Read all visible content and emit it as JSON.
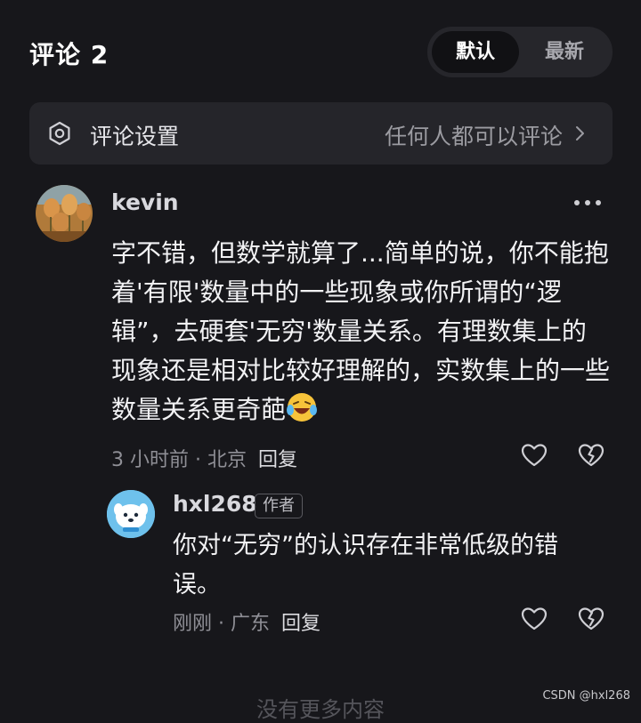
{
  "header": {
    "title": "评论 2"
  },
  "sort": {
    "default_label": "默认",
    "newest_label": "最新"
  },
  "settings": {
    "label": "评论设置",
    "value": "任何人都可以评论"
  },
  "comments": [
    {
      "username": "kevin",
      "text": "字不错，但数学就算了...简单的说，你不能抱着'有限'数量中的一些现象或你所谓的“逻辑”，去硬套'无穷'数量关系。有理数集上的现象还是相对比较好理解的，实数集上的一些数量关系更奇葩",
      "emoji": "laughing-tears-emoji",
      "time": "3 小时前",
      "location": "北京",
      "reply_label": "回复"
    }
  ],
  "replies": [
    {
      "username": "hxl268",
      "badge": "作者",
      "text": "你对“无穷”的认识存在非常低级的错误。",
      "time": "刚刚",
      "location": "广东",
      "reply_label": "回复"
    }
  ],
  "end_note": "没有更多内容",
  "watermark": "CSDN @hxl268",
  "icons": [
    "settings-icon",
    "chevron-right-icon",
    "more-icon",
    "heart-icon",
    "dislike-heart-icon"
  ],
  "colors": {
    "background": "#17171b",
    "card": "#25252a",
    "text": "#f2f2f4",
    "muted": "#8f8f96"
  }
}
